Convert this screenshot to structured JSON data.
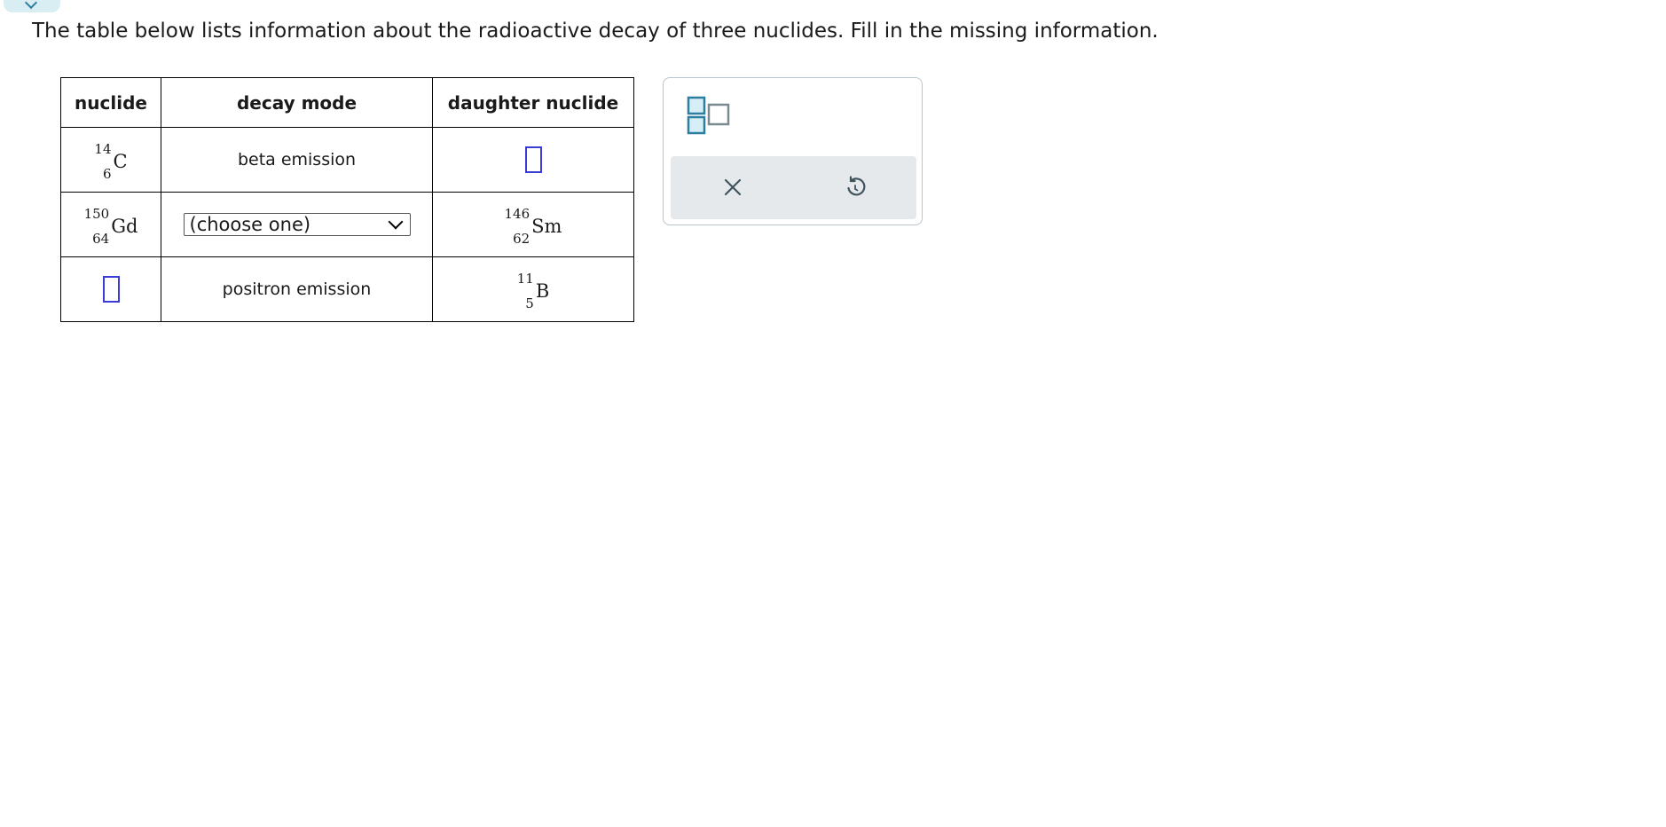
{
  "prompt": "The table below lists information about the radioactive decay of three nuclides. Fill in the missing information.",
  "table": {
    "headers": [
      "nuclide",
      "decay mode",
      "daughter nuclide"
    ],
    "rows": [
      {
        "nuclide": {
          "mass": "14",
          "atomic": "6",
          "symbol": "C"
        },
        "decay_mode": "beta emission",
        "daughter": null
      },
      {
        "nuclide": {
          "mass": "150",
          "atomic": "64",
          "symbol": "Gd"
        },
        "decay_mode_select": "(choose one)",
        "daughter": {
          "mass": "146",
          "atomic": "62",
          "symbol": "Sm"
        }
      },
      {
        "nuclide": null,
        "decay_mode": "positron emission",
        "daughter": {
          "mass": "11",
          "atomic": "5",
          "symbol": "B"
        }
      }
    ]
  },
  "tools": {
    "icons": [
      "superscript-subscript-template-icon",
      "close-icon",
      "undo-icon"
    ],
    "accent_color": "#3b3bd6",
    "icon_color": "#2d7fa0"
  }
}
